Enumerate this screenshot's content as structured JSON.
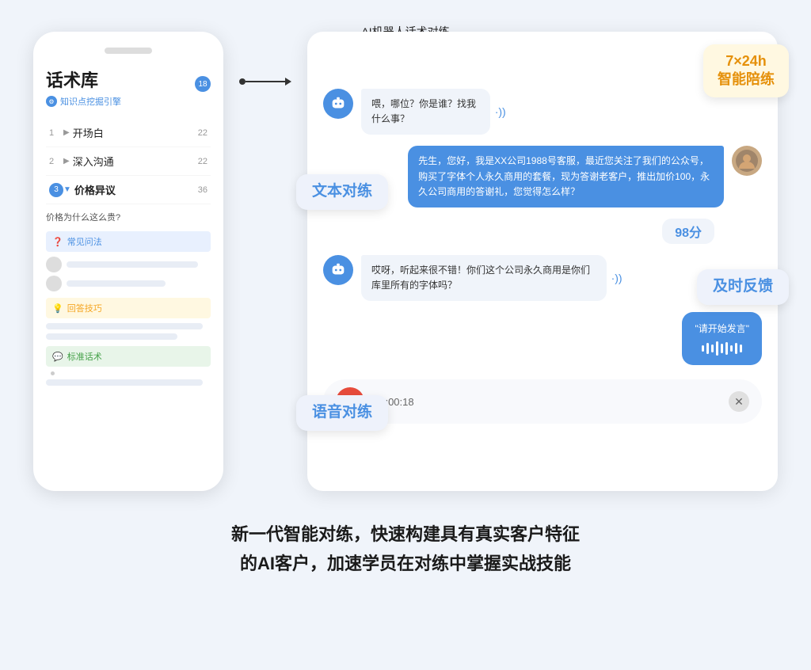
{
  "page": {
    "background": "#f0f4fa"
  },
  "left_panel": {
    "title": "话术库",
    "subtitle": "知识点挖掘引擎",
    "badge": "18",
    "menu": [
      {
        "num": "1",
        "label": "开场白",
        "count": "22",
        "active": false
      },
      {
        "num": "2",
        "label": "深入沟通",
        "count": "22",
        "active": false
      },
      {
        "num": "3",
        "label": "价格异议",
        "count": "36",
        "active": true
      }
    ],
    "question": "价格为什么这么贵?",
    "sections": [
      {
        "id": "faq",
        "label": "常见问法",
        "color": "faq"
      },
      {
        "id": "tips",
        "label": "回答技巧",
        "color": "tips"
      },
      {
        "id": "std",
        "label": "标准话术",
        "color": "std"
      }
    ]
  },
  "arrow": {
    "label": "AI机器人话术对练"
  },
  "chat_panel": {
    "messages": [
      {
        "type": "bot",
        "text": "喂，哪位？你是谁？找我什么事？",
        "has_sound": true
      },
      {
        "type": "user",
        "text": "先生，您好，我是XX公司1988号客服，最近您关注了我们的公众号，购买了字体个人永久商用的套餐，现为答谢老客户，推出加价100，永久公司商用的答谢礼，您觉得怎么样？",
        "has_avatar": true
      },
      {
        "type": "bot",
        "text": "哎呀，听起来很不错！你们这个公司永久商用是你们库里所有的字体吗？",
        "has_sound": true
      },
      {
        "type": "voice_input",
        "text": "\"请开始发言\""
      }
    ],
    "score": "98分",
    "voice_controls": {
      "timer": "00:00:18"
    }
  },
  "float_labels": {
    "smart_train": "7×24h\n智能陪练",
    "text_practice": "文本对练",
    "timely_feedback": "及时反馈",
    "voice_practice": "语音对练"
  },
  "bottom_text": {
    "line1": "新一代智能对练，快速构建具有真实客户特征",
    "line2": "的AI客户，加速学员在对练中掌握实战技能"
  }
}
